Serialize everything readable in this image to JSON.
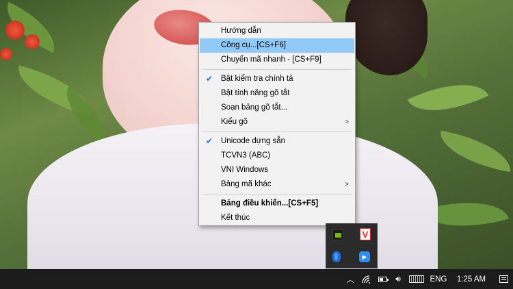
{
  "menu": {
    "items": [
      {
        "label": "Hướng dẫn"
      },
      {
        "label": "Công cụ...[CS+F6]"
      },
      {
        "label": "Chuyển mã nhanh - [CS+F9]"
      },
      {
        "label": "Bật kiểm tra chính tả"
      },
      {
        "label": "Bật tính năng gõ tắt"
      },
      {
        "label": "Soạn bảng gõ tắt..."
      },
      {
        "label": "Kiểu gõ"
      },
      {
        "label": "Unicode dựng sẵn"
      },
      {
        "label": "TCVN3 (ABC)"
      },
      {
        "label": "VNI Windows"
      },
      {
        "label": "Bảng mã khác"
      },
      {
        "label": "Bảng điều khiển...[CS+F5]"
      },
      {
        "label": "Kết thúc"
      }
    ],
    "highlighted_index": 1,
    "checked": [
      "Bật kiểm tra chính tả",
      "Unicode dựng sẵn"
    ],
    "highlight_color": "#91c9f7"
  },
  "tray_popup": {
    "icons": [
      "nvidia-icon",
      "vivaldi-icon",
      "bluetooth-icon",
      "zoom-icon"
    ],
    "v_glyph": "V"
  },
  "taskbar": {
    "language": "ENG",
    "time": "1:25 AM",
    "icons": [
      "show-hidden-icons-chevron",
      "wifi-icon",
      "battery-icon",
      "volume-icon",
      "touch-keyboard-icon",
      "notifications-icon"
    ],
    "battery_level": 0.5
  }
}
